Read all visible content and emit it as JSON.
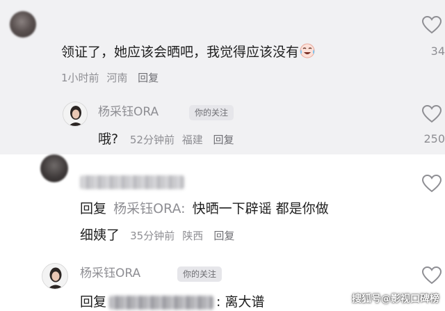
{
  "comments": [
    {
      "text": "领证了，她应该会晒吧，我觉得应该没有",
      "emoji_icon": "crying-laughing-face-icon",
      "time": "1小时前",
      "location": "河南",
      "reply_label": "回复",
      "likes": "34"
    }
  ],
  "reply_1": {
    "username": "杨采钰ORA",
    "badge": "你的关注",
    "text": "哦?",
    "time": "52分钟前",
    "location": "福建",
    "reply_label": "回复",
    "likes": "250"
  },
  "comment_2": {
    "reply_prefix": "回复",
    "reply_target": "杨采钰ORA:",
    "text_line1": "快晒一下辟谣 都是你做",
    "text_line2": "细姨了",
    "time": "35分钟前",
    "location": "陕西",
    "reply_label": "回复"
  },
  "reply_2": {
    "username": "杨采钰ORA",
    "badge": "你的关注",
    "reply_prefix": "回复",
    "text": ": 离大谱"
  },
  "watermark": "搜狐号@影视口碑榜",
  "colors": {
    "top_background": "#f1f1f3",
    "bottom_background": "#ffffff",
    "meta_text": "#8e8e93",
    "main_text": "#1f1f1f"
  }
}
